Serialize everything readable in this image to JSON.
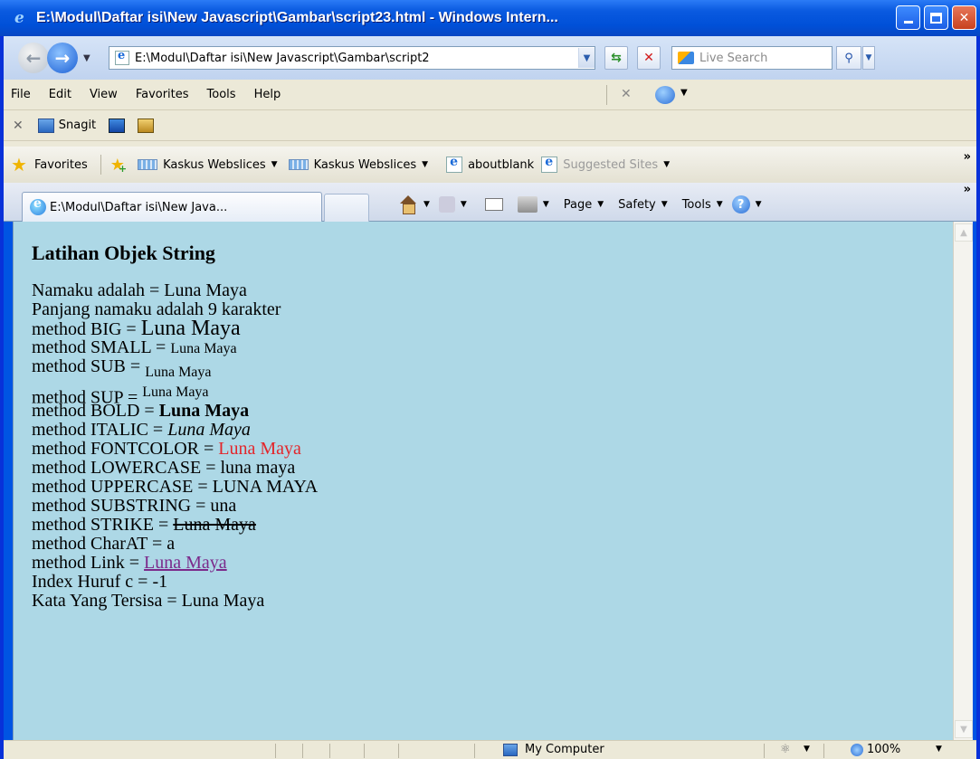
{
  "window": {
    "title": "E:\\Modul\\Daftar isi\\New Javascript\\Gambar\\script23.html - Windows Intern..."
  },
  "address": {
    "url": "E:\\Modul\\Daftar isi\\New Javascript\\Gambar\\script2",
    "search_placeholder": "Live Search"
  },
  "menu": {
    "items": [
      "File",
      "Edit",
      "View",
      "Favorites",
      "Tools",
      "Help"
    ]
  },
  "snagit": {
    "label": "Snagit"
  },
  "favorites_bar": {
    "favorites_label": "Favorites",
    "items": [
      {
        "label": "Kaskus Webslices"
      },
      {
        "label": "Kaskus Webslices"
      },
      {
        "label": "aboutblank"
      },
      {
        "label": "Suggested Sites"
      }
    ]
  },
  "tabs": {
    "active_tab_label": "E:\\Modul\\Daftar isi\\New Java..."
  },
  "command_bar": {
    "page_label": "Page",
    "safety_label": "Safety",
    "tools_label": "Tools"
  },
  "content": {
    "heading": "Latihan Objek String",
    "lines": [
      {
        "prefix": "Namaku adalah = ",
        "value": "Luna Maya"
      },
      {
        "prefix": "Panjang namaku adalah 9 karakter",
        "value": ""
      },
      {
        "prefix": "method BIG = ",
        "value": "Luna Maya"
      },
      {
        "prefix": "method SMALL = ",
        "value": "Luna Maya"
      },
      {
        "prefix": "method SUB = ",
        "value": "Luna Maya"
      },
      {
        "prefix": "method SUP = ",
        "value": "Luna Maya"
      },
      {
        "prefix": "method BOLD = ",
        "value": "Luna Maya"
      },
      {
        "prefix": "method ITALIC = ",
        "value": "Luna Maya"
      },
      {
        "prefix": "method FONTCOLOR = ",
        "value": "Luna Maya"
      },
      {
        "prefix": "method LOWERCASE = ",
        "value": "luna maya"
      },
      {
        "prefix": "method UPPERCASE = ",
        "value": "LUNA MAYA"
      },
      {
        "prefix": "method SUBSTRING = ",
        "value": "una"
      },
      {
        "prefix": "method STRIKE = ",
        "value": "Luna Maya"
      },
      {
        "prefix": "method CharAT = ",
        "value": "a"
      },
      {
        "prefix": "method Link = ",
        "value": "Luna Maya"
      },
      {
        "prefix": "Index Huruf c = -1",
        "value": ""
      },
      {
        "prefix": "Kata Yang Tersisa = ",
        "value": "Luna Maya"
      }
    ]
  },
  "status": {
    "zone": "My Computer",
    "zoom": "100%"
  },
  "colors": {
    "content_bg": "#add8e6",
    "fontcolor_red": "#e3262b",
    "link_purple": "#7b2a8b"
  }
}
